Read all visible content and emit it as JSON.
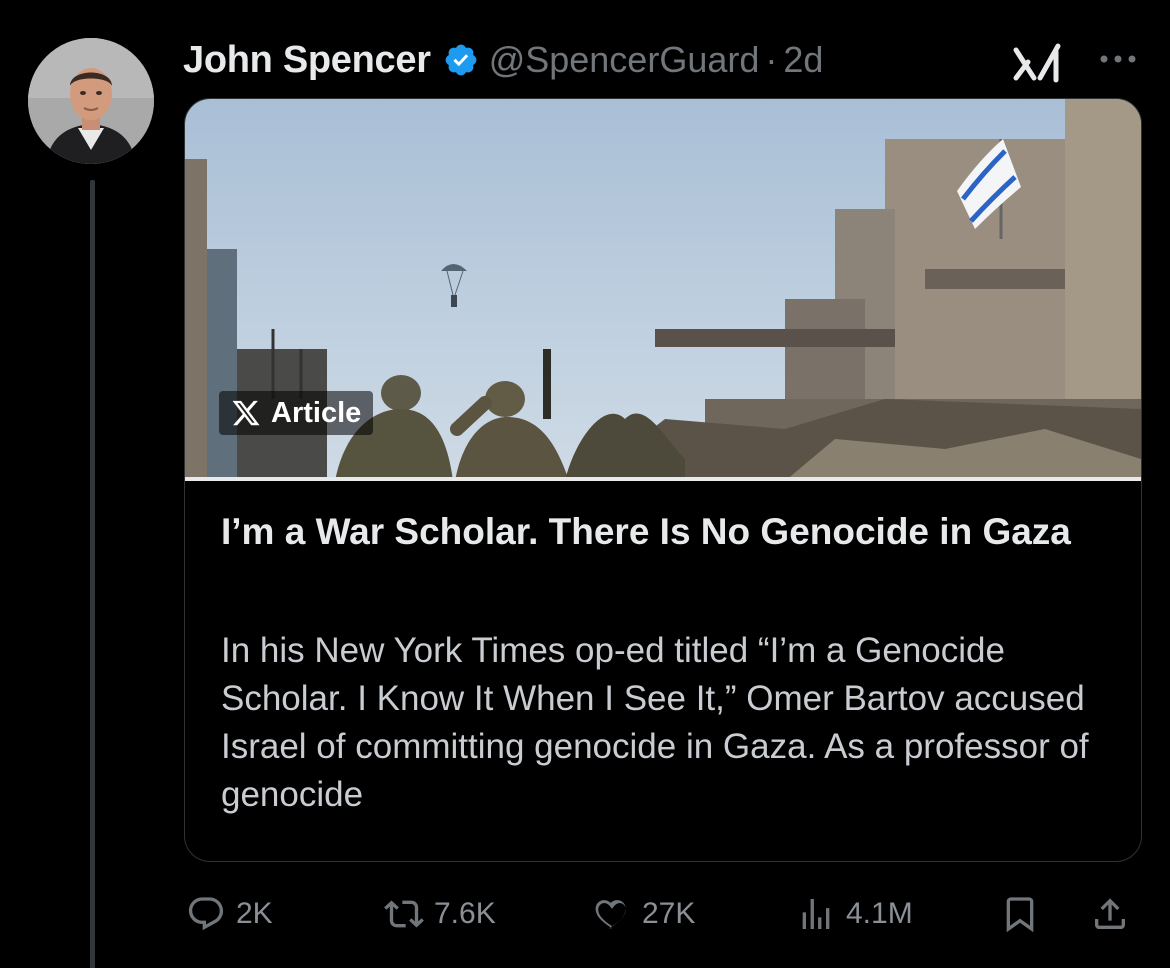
{
  "author": {
    "name": "John Spencer",
    "handle": "@SpencerGuard",
    "separator": "·",
    "time": "2d",
    "verified_color": "#1d9bf0"
  },
  "article": {
    "badge": "Article",
    "title": "I’m a War Scholar. There Is No Genocide in Gaza",
    "excerpt": "In his New York Times op-ed titled “I’m a Genocide Scholar. I Know It When I See It,” Omer Bartov accused Israel of committing genocide in Gaza. As a professor of genocide"
  },
  "actions": {
    "replies": "2K",
    "reposts": "7.6K",
    "likes": "27K",
    "views": "4.1M"
  },
  "icons": [
    "verified-badge-icon",
    "grok-icon",
    "more-icon",
    "x-logo-icon",
    "reply-icon",
    "repost-icon",
    "like-icon",
    "views-icon",
    "bookmark-icon",
    "share-icon"
  ]
}
